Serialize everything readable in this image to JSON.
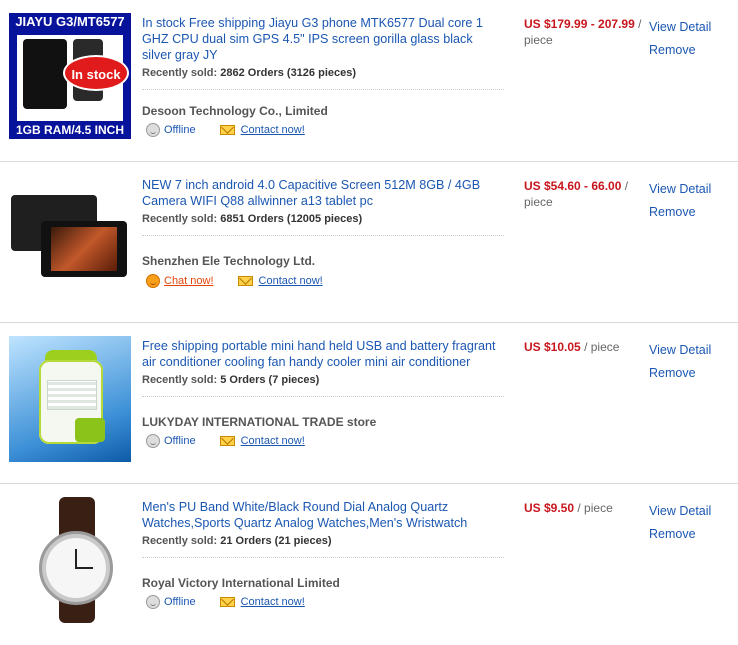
{
  "items": [
    {
      "thumb": {
        "top_text": "JIAYU G3/MT6577",
        "bottom_text": "1GB RAM/4.5 INCH",
        "badge": "In stock"
      },
      "title": "In stock Free shipping Jiayu G3 phone MTK6577 Dual core 1 GHZ CPU dual sim GPS 4.5\" IPS screen gorilla glass black silver gray JY",
      "sold_label": "Recently sold:",
      "sold_value": "2862 Orders (3126 pieces)",
      "store": "Desoon Technology Co., Limited",
      "status": "Offline",
      "contact": "Contact now!",
      "price": "US $179.99 - 207.99",
      "unit": "/ piece",
      "view": "View Detail",
      "remove": "Remove"
    },
    {
      "title": "NEW 7 inch android 4.0 Capacitive Screen 512M 8GB / 4GB Camera WIFI Q88 allwinner a13 tablet pc",
      "sold_label": "Recently sold:",
      "sold_value": "6851 Orders (12005 pieces)",
      "store": "Shenzhen Ele Technology Ltd.",
      "status": "Chat now!",
      "contact": "Contact now!",
      "price": "US $54.60 - 66.00",
      "unit": "/ piece",
      "view": "View Detail",
      "remove": "Remove"
    },
    {
      "title": "Free shipping portable mini hand held USB and battery fragrant air conditioner cooling fan handy cooler mini air conditioner",
      "sold_label": "Recently sold:",
      "sold_value": "5 Orders (7 pieces)",
      "store": "LUKYDAY INTERNATIONAL TRADE store",
      "status": "Offline",
      "contact": "Contact now!",
      "price": "US $10.05",
      "unit": "/ piece",
      "view": "View Detail",
      "remove": "Remove"
    },
    {
      "title": "Men's PU Band White/Black Round Dial Analog Quartz Watches,Sports Quartz Analog Watches,Men's Wristwatch",
      "sold_label": "Recently sold:",
      "sold_value": "21 Orders (21 pieces)",
      "store": "Royal Victory International Limited",
      "status": "Offline",
      "contact": "Contact now!",
      "price": "US $9.50",
      "unit": "/ piece",
      "view": "View Detail",
      "remove": "Remove"
    }
  ]
}
